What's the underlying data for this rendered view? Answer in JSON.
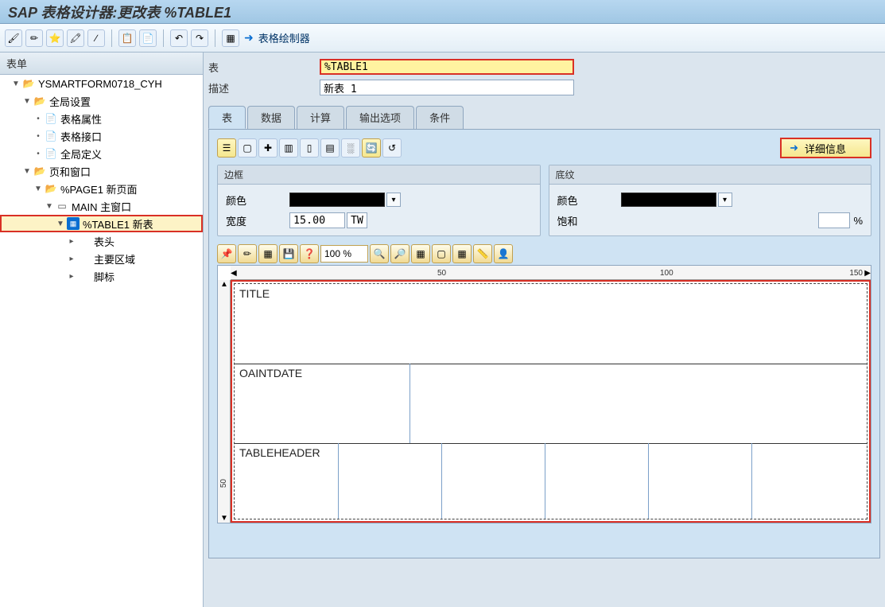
{
  "title": "SAP 表格设计器:更改表 %TABLE1",
  "mainTool": {
    "paint1": "🖌",
    "paint2": "✏",
    "paint3": "⭐",
    "paint4": "🖍",
    "paint5": "∕",
    "copy": "📋",
    "paste": "📄",
    "undo": "↶",
    "redo": "↷",
    "layout": "▦",
    "arrow": "➜",
    "painter": "表格绘制器"
  },
  "left": {
    "header": "表单",
    "tree": [
      {
        "indent": 1,
        "toggle": "▼",
        "icon": "📂",
        "cls": "folder",
        "text": "YSMARTFORM0718_CYH"
      },
      {
        "indent": 2,
        "toggle": "▼",
        "icon": "📂",
        "cls": "folder",
        "text": "全局设置"
      },
      {
        "indent": 3,
        "toggle": "•",
        "icon": "📄",
        "cls": "page-icon",
        "text": "表格属性"
      },
      {
        "indent": 3,
        "toggle": "•",
        "icon": "📄",
        "cls": "page-icon",
        "text": "表格接口"
      },
      {
        "indent": 3,
        "toggle": "•",
        "icon": "📄",
        "cls": "page-icon",
        "text": "全局定义"
      },
      {
        "indent": 2,
        "toggle": "▼",
        "icon": "📂",
        "cls": "folder",
        "text": "页和窗口"
      },
      {
        "indent": 3,
        "toggle": "▼",
        "icon": "📂",
        "cls": "folder",
        "text": "%PAGE1 新页面"
      },
      {
        "indent": 4,
        "toggle": "▼",
        "icon": "▭",
        "cls": "page-icon",
        "text": "MAIN 主窗口"
      },
      {
        "indent": 5,
        "toggle": "▼",
        "icon": "▦",
        "cls": "table-icon",
        "text": "%TABLE1 新表",
        "selected": true
      },
      {
        "indent": 6,
        "toggle": "▸",
        "icon": "",
        "cls": "",
        "text": "表头"
      },
      {
        "indent": 6,
        "toggle": "▸",
        "icon": "",
        "cls": "",
        "text": "主要区域"
      },
      {
        "indent": 6,
        "toggle": "▸",
        "icon": "",
        "cls": "",
        "text": "脚标"
      }
    ]
  },
  "fields": {
    "tableLabel": "表",
    "tableValue": "%TABLE1",
    "descLabel": "描述",
    "descValue": "新表 1"
  },
  "tabs": [
    {
      "label": "表",
      "active": true
    },
    {
      "label": "数据"
    },
    {
      "label": "计算"
    },
    {
      "label": "输出选项"
    },
    {
      "label": "条件"
    }
  ],
  "tools": {
    "a": "☰",
    "b": "▢",
    "c": "✚",
    "d": "▥",
    "e": "▯",
    "f": "▤",
    "g": "░",
    "h": "🔄",
    "i": "↺"
  },
  "detailIcon": "➜",
  "detailLabel": "详细信息",
  "border": {
    "title": "边框",
    "colorLabel": "颜色",
    "widthLabel": "宽度",
    "widthValue": "15.00",
    "unit": "TW"
  },
  "shading": {
    "title": "底纹",
    "colorLabel": "颜色",
    "satLabel": "饱和",
    "satUnit": "%"
  },
  "editorTools": {
    "pin": "📌",
    "pen": "✏",
    "grid": "▦",
    "save": "💾",
    "help": "❓",
    "zoom": "100 %",
    "zin": "🔍",
    "zout": "🔎",
    "sel": "▦",
    "g1": "▢",
    "g2": "▦",
    "m": "📏",
    "u": "👤"
  },
  "ruler": {
    "t1": "50",
    "t2": "100",
    "t3": "150",
    "v1": "50"
  },
  "cells": {
    "r1": "TITLE",
    "r2": "OAINTDATE",
    "r3": "TABLEHEADER"
  }
}
